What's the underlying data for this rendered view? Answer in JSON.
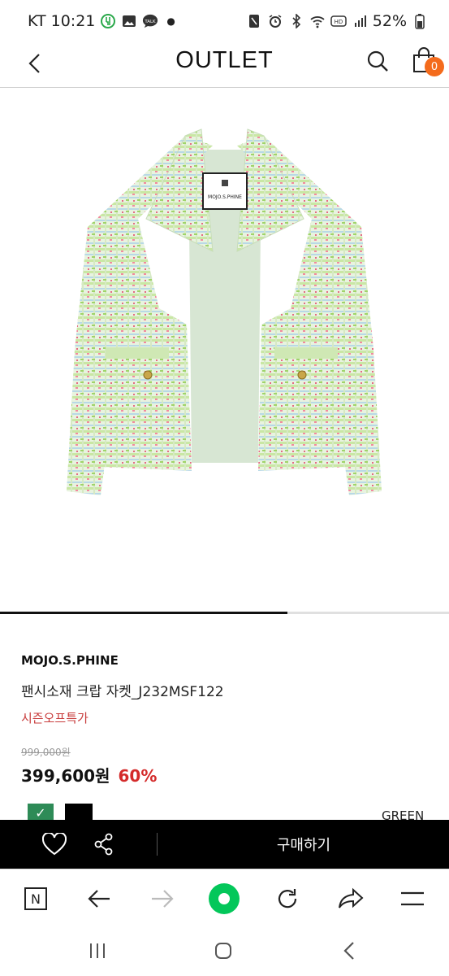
{
  "status_bar": {
    "carrier_time": "KT 10:21",
    "battery": "52%",
    "left_icons": [
      "spoon-icon",
      "image-icon",
      "talk-icon"
    ],
    "right_icons": [
      "nfc-icon",
      "alarm-icon",
      "bluetooth-icon",
      "wifi-icon",
      "hd-icon",
      "signal-icon",
      "battery-icon"
    ],
    "talk_label": "TALK"
  },
  "header": {
    "title": "OUTLET",
    "cart_count": "0"
  },
  "product_image": {
    "tag_label": "MOJO.S.PHINE",
    "slider_progress": 0.64
  },
  "product": {
    "brand": "MOJO.S.PHINE",
    "name": "팬시소재 크랍 자켓_J232MSF122",
    "promo": "시즌오프특가",
    "original_price": "999,000원",
    "sale_price": "399,600원",
    "discount": "60%",
    "color_label": "GREEN",
    "swatch_colors": [
      "#2e8b57",
      "#000000"
    ]
  },
  "action_bar": {
    "buy_label": "구매하기"
  },
  "browser_bar": {
    "n_label": "N",
    "accent": "#03c75a"
  }
}
